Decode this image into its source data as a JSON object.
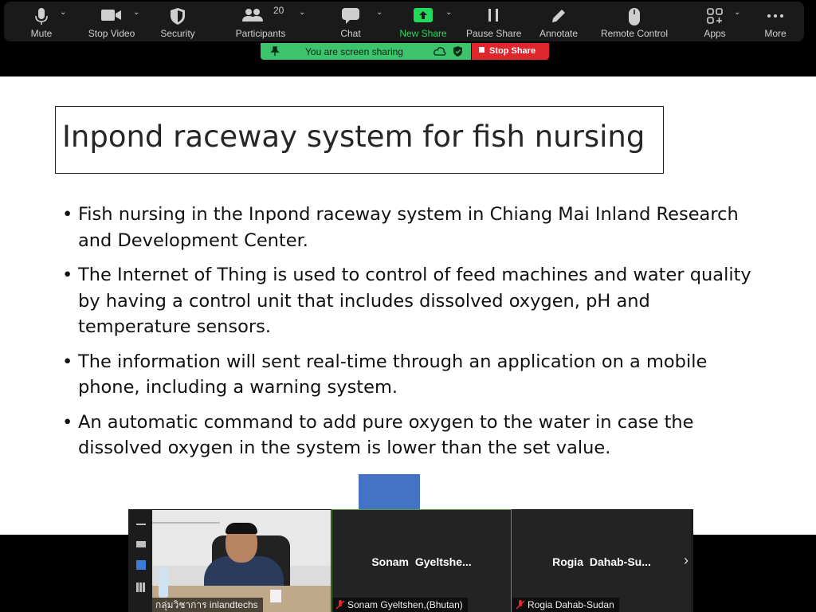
{
  "toolbar": {
    "mute": "Mute",
    "stop_video": "Stop Video",
    "security": "Security",
    "participants": "Participants",
    "participants_count": "20",
    "chat": "Chat",
    "new_share": "New Share",
    "pause_share": "Pause Share",
    "annotate": "Annotate",
    "remote_control": "Remote Control",
    "apps": "Apps",
    "more": "More"
  },
  "share_bar": {
    "status": "You are screen sharing",
    "stop": "Stop Share"
  },
  "slide": {
    "title": "Inpond raceway system for fish nursing",
    "bullets": [
      "Fish nursing in the Inpond raceway system in Chiang Mai Inland Research and Development Center.",
      "The Internet of Thing is used to control of feed machines and water quality by having a control unit that includes dissolved oxygen, pH and temperature sensors.",
      "The information will sent real-time through an application on a mobile phone, including a warning system.",
      "An automatic command to add pure oxygen to the water in case the dissolved oxygen in the system is lower than the set value."
    ]
  },
  "participants": [
    {
      "display_name": "",
      "footer": "กลุ่มวิชาการ inlandtechs"
    },
    {
      "display_name": "Sonam  Gyeltshe...",
      "footer": "Sonam Gyeltshen,(Bhutan)"
    },
    {
      "display_name": "Rogia  Dahab-Su...",
      "footer": "Rogia Dahab-Sudan"
    }
  ],
  "colors": {
    "toolbar_bg": "#1a1a1a",
    "share_green": "#3cc36b",
    "stop_red": "#e0262d",
    "active_green": "#23d959"
  }
}
